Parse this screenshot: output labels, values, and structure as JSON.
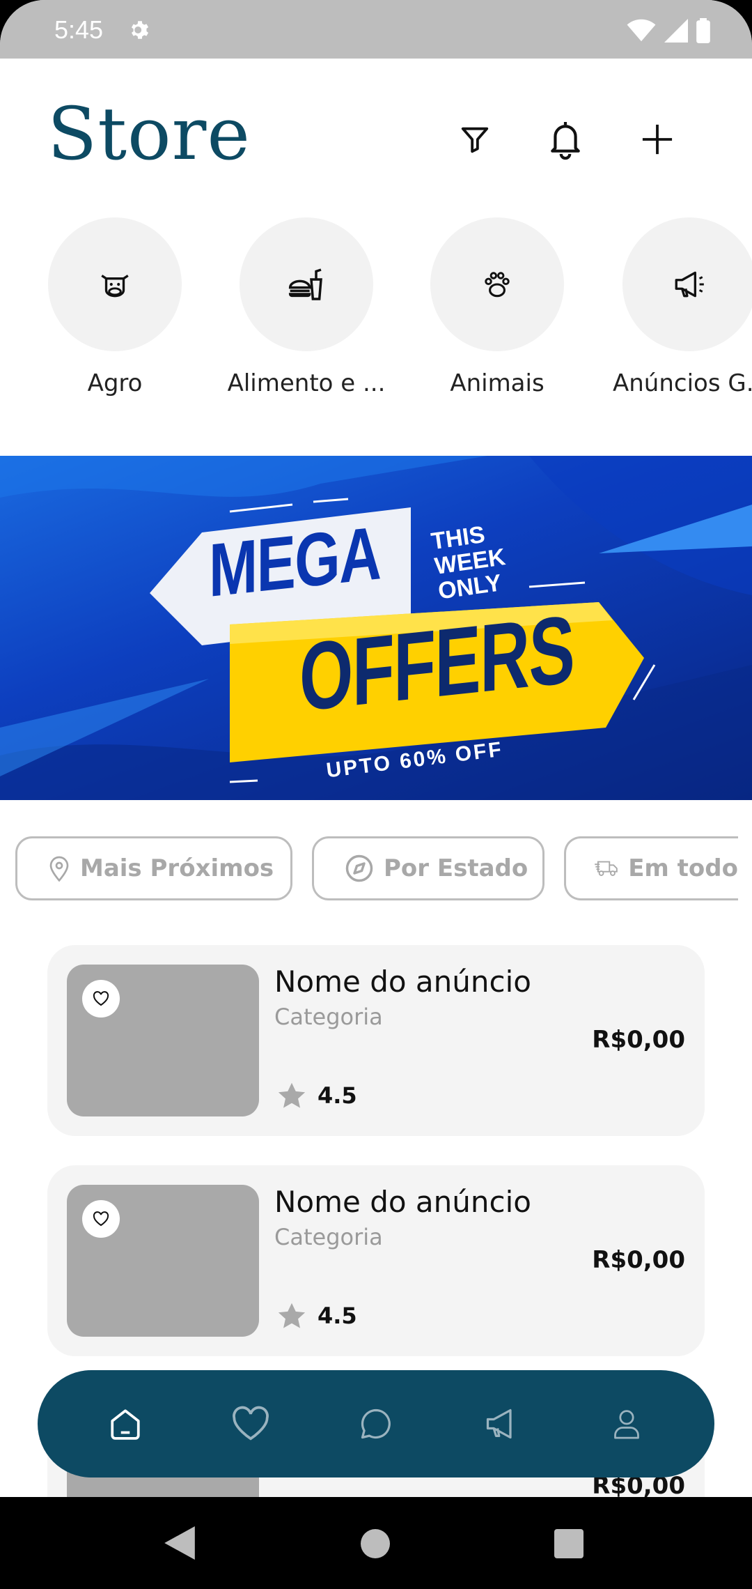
{
  "status_bar": {
    "time": "5:45"
  },
  "header": {
    "title": "Store"
  },
  "categories": [
    {
      "label": "Agro",
      "icon": "cow-icon"
    },
    {
      "label": "Alimento e ...",
      "icon": "food-icon"
    },
    {
      "label": "Animais",
      "icon": "paw-icon"
    },
    {
      "label": "Anúncios G...",
      "icon": "megaphone-icon"
    }
  ],
  "banner": {
    "line1": "MEGA",
    "line2": "OFFERS",
    "side_line1": "THIS",
    "side_line2": "WEEK",
    "side_line3": "ONLY",
    "footer": "UPTO 60% OFF",
    "colors": {
      "bg": "#0d3fbf",
      "accent": "#ffd400",
      "text": "#0a36b0"
    }
  },
  "filters": [
    {
      "label": "Mais Próximos",
      "icon": "location-pin-icon"
    },
    {
      "label": "Por Estado",
      "icon": "compass-icon"
    },
    {
      "label": "Em todo",
      "icon": "truck-icon"
    }
  ],
  "listings": [
    {
      "name": "Nome do anúncio",
      "category": "Categoria",
      "price": "R$0,00",
      "rating": "4.5"
    },
    {
      "name": "Nome do anúncio",
      "category": "Categoria",
      "price": "R$0,00",
      "rating": "4.5"
    },
    {
      "price": "R$0,00"
    }
  ],
  "bottom_nav": [
    "home-icon",
    "heart-icon",
    "chat-icon",
    "megaphone-icon",
    "profile-icon"
  ],
  "colors": {
    "brand": "#0d4a63",
    "card_bg": "#f4f4f4",
    "muted": "#a8a8a8"
  }
}
